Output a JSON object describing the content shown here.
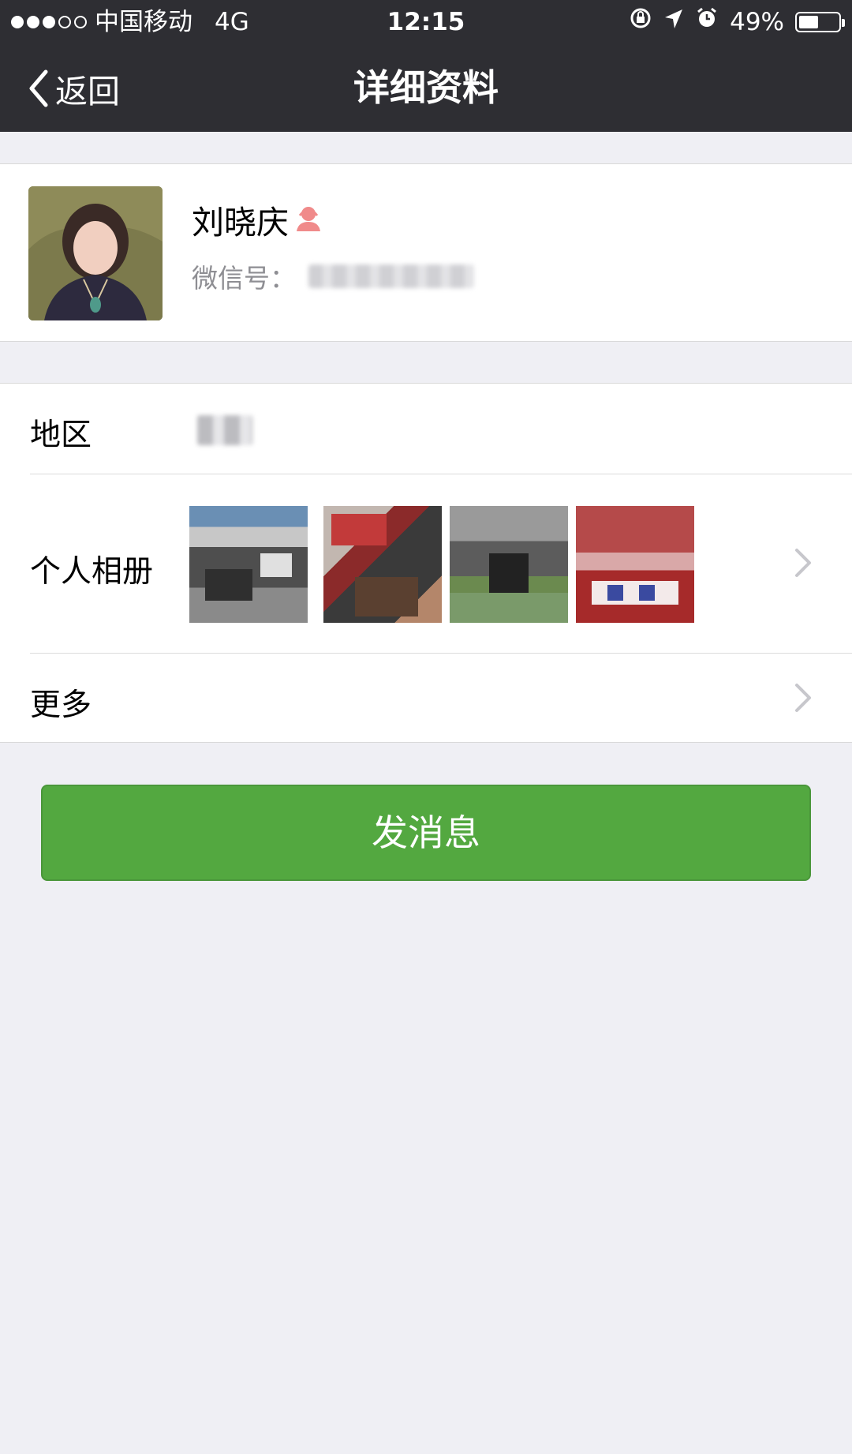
{
  "status_bar": {
    "signal_dots_filled": 3,
    "signal_dots_total": 5,
    "carrier": "中国移动",
    "network": "4G",
    "time": "12:15",
    "battery": "49%",
    "battery_level": 0.49
  },
  "nav": {
    "back_label": "返回",
    "title": "详细资料"
  },
  "profile": {
    "name": "刘晓庆",
    "gender_icon": "female-icon",
    "wechat_id_label": "微信号："
  },
  "info_rows": {
    "region_label": "地区",
    "album_label": "个人相册",
    "more_label": "更多"
  },
  "actions": {
    "send_message": "发消息"
  },
  "colors": {
    "nav_bg": "#2e2e33",
    "page_bg": "#efeff4",
    "button_green": "#53a840",
    "gender_pink": "#f08a8a"
  }
}
